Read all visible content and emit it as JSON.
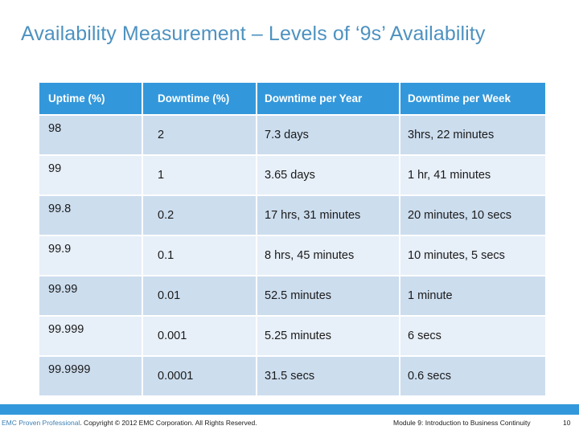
{
  "slide": {
    "title": "Availability Measurement – Levels of ‘9s’ Availability",
    "title_color": "#4E92C0"
  },
  "table": {
    "header_bg": "#3398DB",
    "row_dark_bg": "#CCDDEE",
    "row_light_bg": "#E7EFF8",
    "columns": [
      "Uptime (%)",
      "Downtime (%)",
      "Downtime per Year",
      "Downtime per Week"
    ],
    "rows": [
      [
        "98",
        "2",
        "7.3 days",
        "3hrs, 22 minutes"
      ],
      [
        "99",
        "1",
        "3.65 days",
        "1 hr, 41 minutes"
      ],
      [
        "99.8",
        "0.2",
        "17 hrs, 31 minutes",
        "20 minutes, 10 secs"
      ],
      [
        "99.9",
        "0.1",
        "8 hrs, 45 minutes",
        "10 minutes, 5 secs"
      ],
      [
        "99.99",
        "0.01",
        "52.5 minutes",
        "1 minute"
      ],
      [
        "99.999",
        "0.001",
        "5.25 minutes",
        "6 secs"
      ],
      [
        "99.9999",
        "0.0001",
        "31.5 secs",
        "0.6 secs"
      ]
    ]
  },
  "footer": {
    "brand": "EMC Proven Professional",
    "copyright": ". Copyright © 2012 EMC Corporation. All Rights Reserved.",
    "module": "Module 9: Introduction to Business Continuity",
    "page_number": "10",
    "bar_color": "#3398DB"
  }
}
